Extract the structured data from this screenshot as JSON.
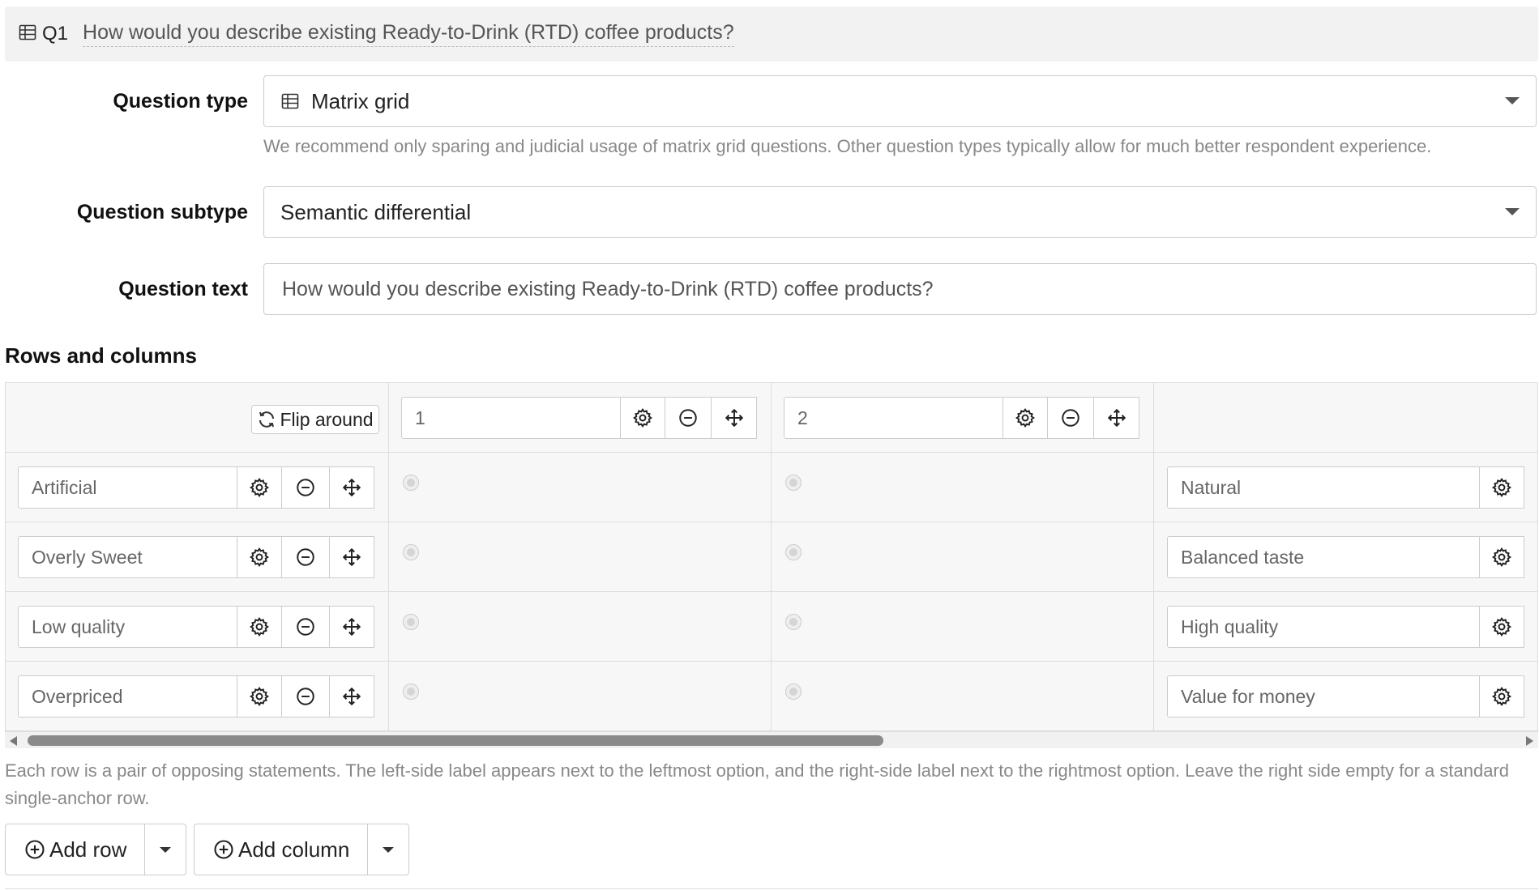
{
  "question": {
    "number": "Q1",
    "title": "How would you describe existing Ready-to-Drink (RTD) coffee products?"
  },
  "fields": {
    "question_type": {
      "label": "Question type",
      "value": "Matrix grid"
    },
    "question_type_help": "We recommend only sparing and judicial usage of matrix grid questions. Other question types typically allow for much better respondent experience.",
    "question_subtype": {
      "label": "Question subtype",
      "value": "Semantic differential"
    },
    "question_text": {
      "label": "Question text",
      "value": "How would you describe existing Ready-to-Drink (RTD) coffee products?"
    }
  },
  "grid": {
    "section_title": "Rows and columns",
    "flip_label": "Flip around",
    "columns": [
      "1",
      "2"
    ],
    "rows": [
      {
        "left": "Artificial",
        "right": "Natural"
      },
      {
        "left": "Overly Sweet",
        "right": "Balanced taste"
      },
      {
        "left": "Low quality",
        "right": "High quality"
      },
      {
        "left": "Overpriced",
        "right": "Value for money"
      }
    ],
    "help": "Each row is a pair of opposing statements. The left-side label appears next to the leftmost option, and the right-side label next to the rightmost option. Leave the right side empty for a standard single-anchor row."
  },
  "buttons": {
    "add_row": "Add row",
    "add_column": "Add column"
  },
  "icons": [
    "grid-icon",
    "gear-icon",
    "minus-circle-icon",
    "move-icon",
    "refresh-icon",
    "plus-circle-icon",
    "caret-down-icon"
  ]
}
